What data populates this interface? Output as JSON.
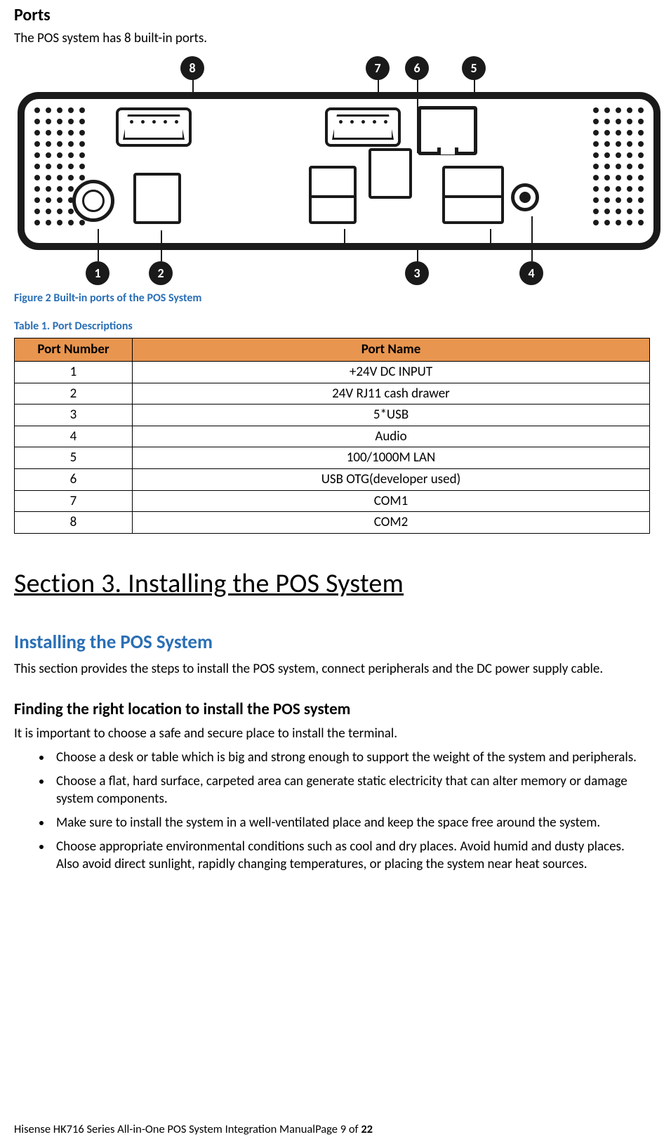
{
  "headings": {
    "ports": "Ports",
    "section3": "Section 3. Installing the POS System",
    "installing": "Installing the POS System",
    "finding": "Finding the right location to install the POS system"
  },
  "intro": "The POS system has 8 built-in ports.",
  "fig_caption": "Figure 2 Built-in ports of the POS System",
  "table_caption": "Table 1. Port Descriptions",
  "table": {
    "head": {
      "num": "Port Number",
      "name": "Port Name"
    },
    "rows": [
      {
        "num": "1",
        "name": "+24V DC INPUT"
      },
      {
        "num": "2",
        "name": "24V RJ11 cash drawer"
      },
      {
        "num": "3",
        "name": "5*USB"
      },
      {
        "num": "4",
        "name": "Audio"
      },
      {
        "num": "5",
        "name": "100/1000M LAN"
      },
      {
        "num": "6",
        "name": "USB OTG(developer used)"
      },
      {
        "num": "7",
        "name": "COM1"
      },
      {
        "num": "8",
        "name": "COM2"
      }
    ]
  },
  "installing_body": "This section provides the steps to install the POS system, connect peripherals and the DC power supply cable.",
  "location_intro": "It is important to choose a safe and secure place to install the terminal.",
  "bullets": [
    "Choose a desk or table which is big and strong enough to support the weight of the system and peripherals.",
    "Choose a flat, hard surface, carpeted area can generate static electricity that can alter memory or damage system components.",
    "Make sure to install the system in a well-ventilated place and keep the space free around the system.",
    "Choose appropriate environmental conditions such as cool and dry places. Avoid humid and dusty places. Also avoid direct sunlight, rapidly changing temperatures, or placing the system near heat sources."
  ],
  "callouts": {
    "c1": "1",
    "c2": "2",
    "c3": "3",
    "c4": "4",
    "c5": "5",
    "c6": "6",
    "c7": "7",
    "c8": "8"
  },
  "footer": {
    "prefix": "Hisense HK716 Series All-in-One POS System Integration ManualPage ",
    "page": "9",
    "of": " of ",
    "total": "22"
  }
}
